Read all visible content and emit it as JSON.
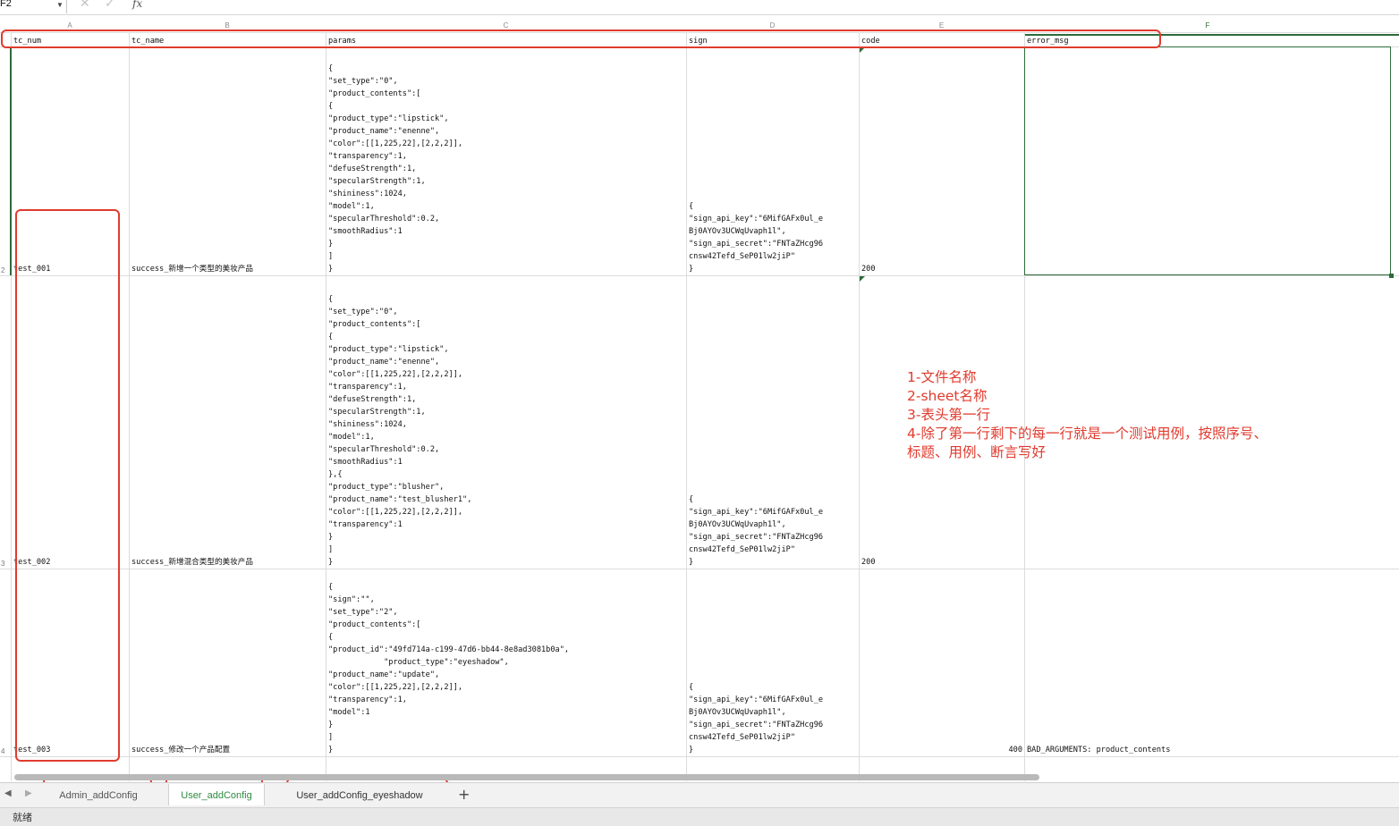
{
  "formula_bar": {
    "name_box": "F2",
    "cancel_icon": "✕",
    "confirm_icon": "✓",
    "fx_label": "fx"
  },
  "columns": [
    "A",
    "B",
    "C",
    "D",
    "E",
    "F"
  ],
  "header_row": {
    "row_number": "1",
    "cells": [
      "tc_num",
      "tc_name",
      "params",
      "sign",
      "code",
      "error_msg"
    ]
  },
  "rows": [
    {
      "row_number": "2",
      "tc_num": "test_001",
      "tc_name": "success_新增一个类型的美妆产品",
      "params": "{\n\"set_type\":\"0\",\n\"product_contents\":[\n{\n\"product_type\":\"lipstick\",\n\"product_name\":\"enenne\",\n\"color\":[[1,225,22],[2,2,2]],\n\"transparency\":1,\n\"defuseStrength\":1,\n\"specularStrength\":1,\n\"shininess\":1024,\n\"model\":1,\n\"specularThreshold\":0.2,\n\"smoothRadius\":1\n}\n]\n}",
      "sign": "{\n\"sign_api_key\":\"6MifGAFx0ul_e\nBj0AYOv3UCWqUvaph1l\",\n\"sign_api_secret\":\"FNTaZHcg96\ncnsw42Tefd_SeP01lw2jiP\"\n}",
      "code": "200",
      "error_msg": ""
    },
    {
      "row_number": "3",
      "tc_num": "test_002",
      "tc_name": "success_新增混合类型的美妆产品",
      "params": "{\n\"set_type\":\"0\",\n\"product_contents\":[\n{\n\"product_type\":\"lipstick\",\n\"product_name\":\"enenne\",\n\"color\":[[1,225,22],[2,2,2]],\n\"transparency\":1,\n\"defuseStrength\":1,\n\"specularStrength\":1,\n\"shininess\":1024,\n\"model\":1,\n\"specularThreshold\":0.2,\n\"smoothRadius\":1\n},{\n\"product_type\":\"blusher\",\n\"product_name\":\"test_blusher1\",\n\"color\":[[1,225,22],[2,2,2]],\n\"transparency\":1\n}\n]\n}",
      "sign": "{\n\"sign_api_key\":\"6MifGAFx0ul_e\nBj0AYOv3UCWqUvaph1l\",\n\"sign_api_secret\":\"FNTaZHcg96\ncnsw42Tefd_SeP01lw2jiP\"\n}",
      "code": "200",
      "error_msg": ""
    },
    {
      "row_number": "4",
      "tc_num": "test_003",
      "tc_name": "success_修改一个产品配置",
      "params": "{\n\"sign\":\"\",\n\"set_type\":\"2\",\n\"product_contents\":[\n{\n\"product_id\":\"49fd714a-c199-47d6-bb44-8e8ad3081b0a\",\n            \"product_type\":\"eyeshadow\",\n\"product_name\":\"update\",\n\"color\":[[1,225,22],[2,2,2]],\n\"transparency\":1,\n\"model\":1\n}\n]\n}",
      "sign": "{\n\"sign_api_key\":\"6MifGAFx0ul_e\nBj0AYOv3UCWqUvaph1l\",\n\"sign_api_secret\":\"FNTaZHcg96\ncnsw42Tefd_SeP01lw2jiP\"\n}",
      "code": "400",
      "error_msg": "BAD_ARGUMENTS: product_contents"
    }
  ],
  "annotation": "1-文件名称\n2-sheet名称\n3-表头第一行\n4-除了第一行剩下的每一行就是一个测试用例，按照序号、\n标题、用例、断言写好",
  "annotation_color": "#e03b2e",
  "accent_color": "#2e6b3a",
  "sheet_tabs": [
    "Admin_addConfig",
    "User_addConfig",
    "User_addConfig_eyeshadow"
  ],
  "active_sheet": "User_addConfig",
  "add_sheet_icon": "+",
  "nav_icons": {
    "prev": "◀",
    "next": "▶"
  },
  "status_text": "就绪"
}
